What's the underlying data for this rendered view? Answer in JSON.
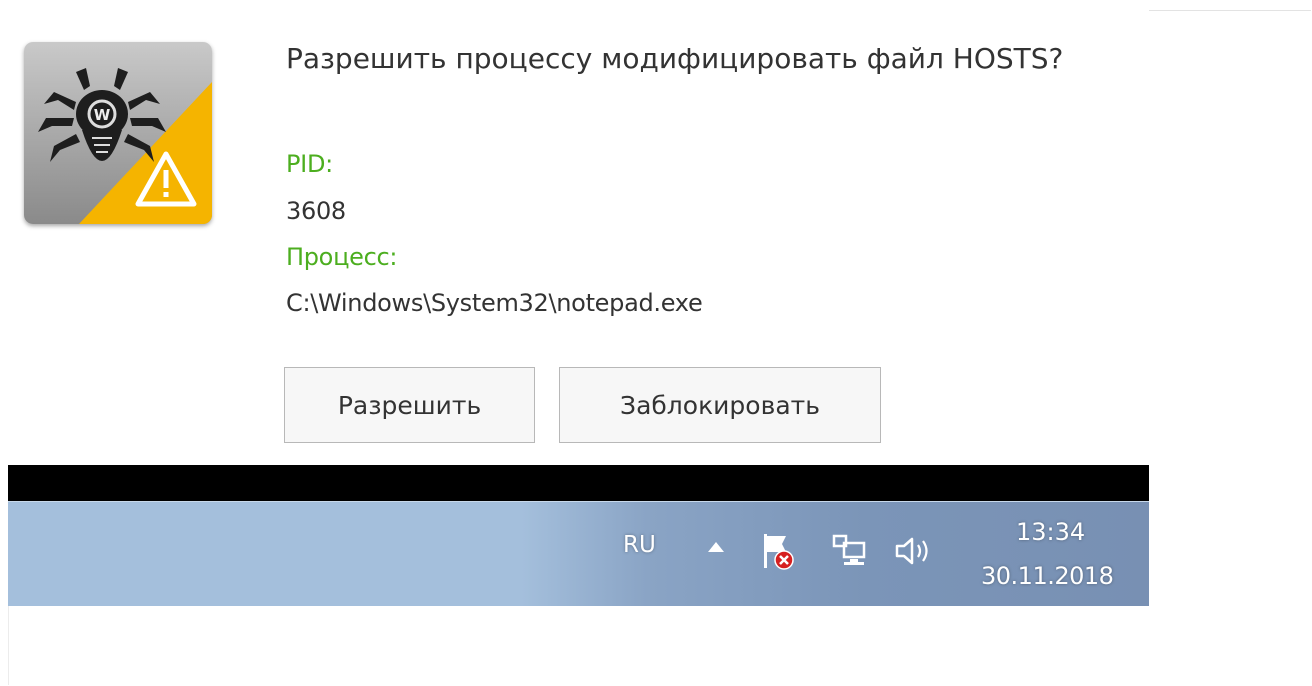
{
  "notification": {
    "title": "Разрешить процессу модифицировать файл HOSTS?",
    "pid_label": "PID:",
    "pid_value": "3608",
    "process_label": "Процесс:",
    "process_value": "C:\\Windows\\System32\\notepad.exe",
    "allow_button": "Разрешить",
    "block_button": "Заблокировать",
    "app_icon": "dr-web-spider-warning-icon"
  },
  "taskbar": {
    "language": "RU",
    "time": "13:34",
    "date": "30.11.2018",
    "tray_icons": [
      "show-hidden-icons-arrow",
      "action-center-flag-icon",
      "network-icon",
      "volume-icon"
    ]
  },
  "colors": {
    "label_green": "#4cae1f",
    "warning_yellow": "#f5b400",
    "taskbar_blue": "#a4bfdc"
  }
}
